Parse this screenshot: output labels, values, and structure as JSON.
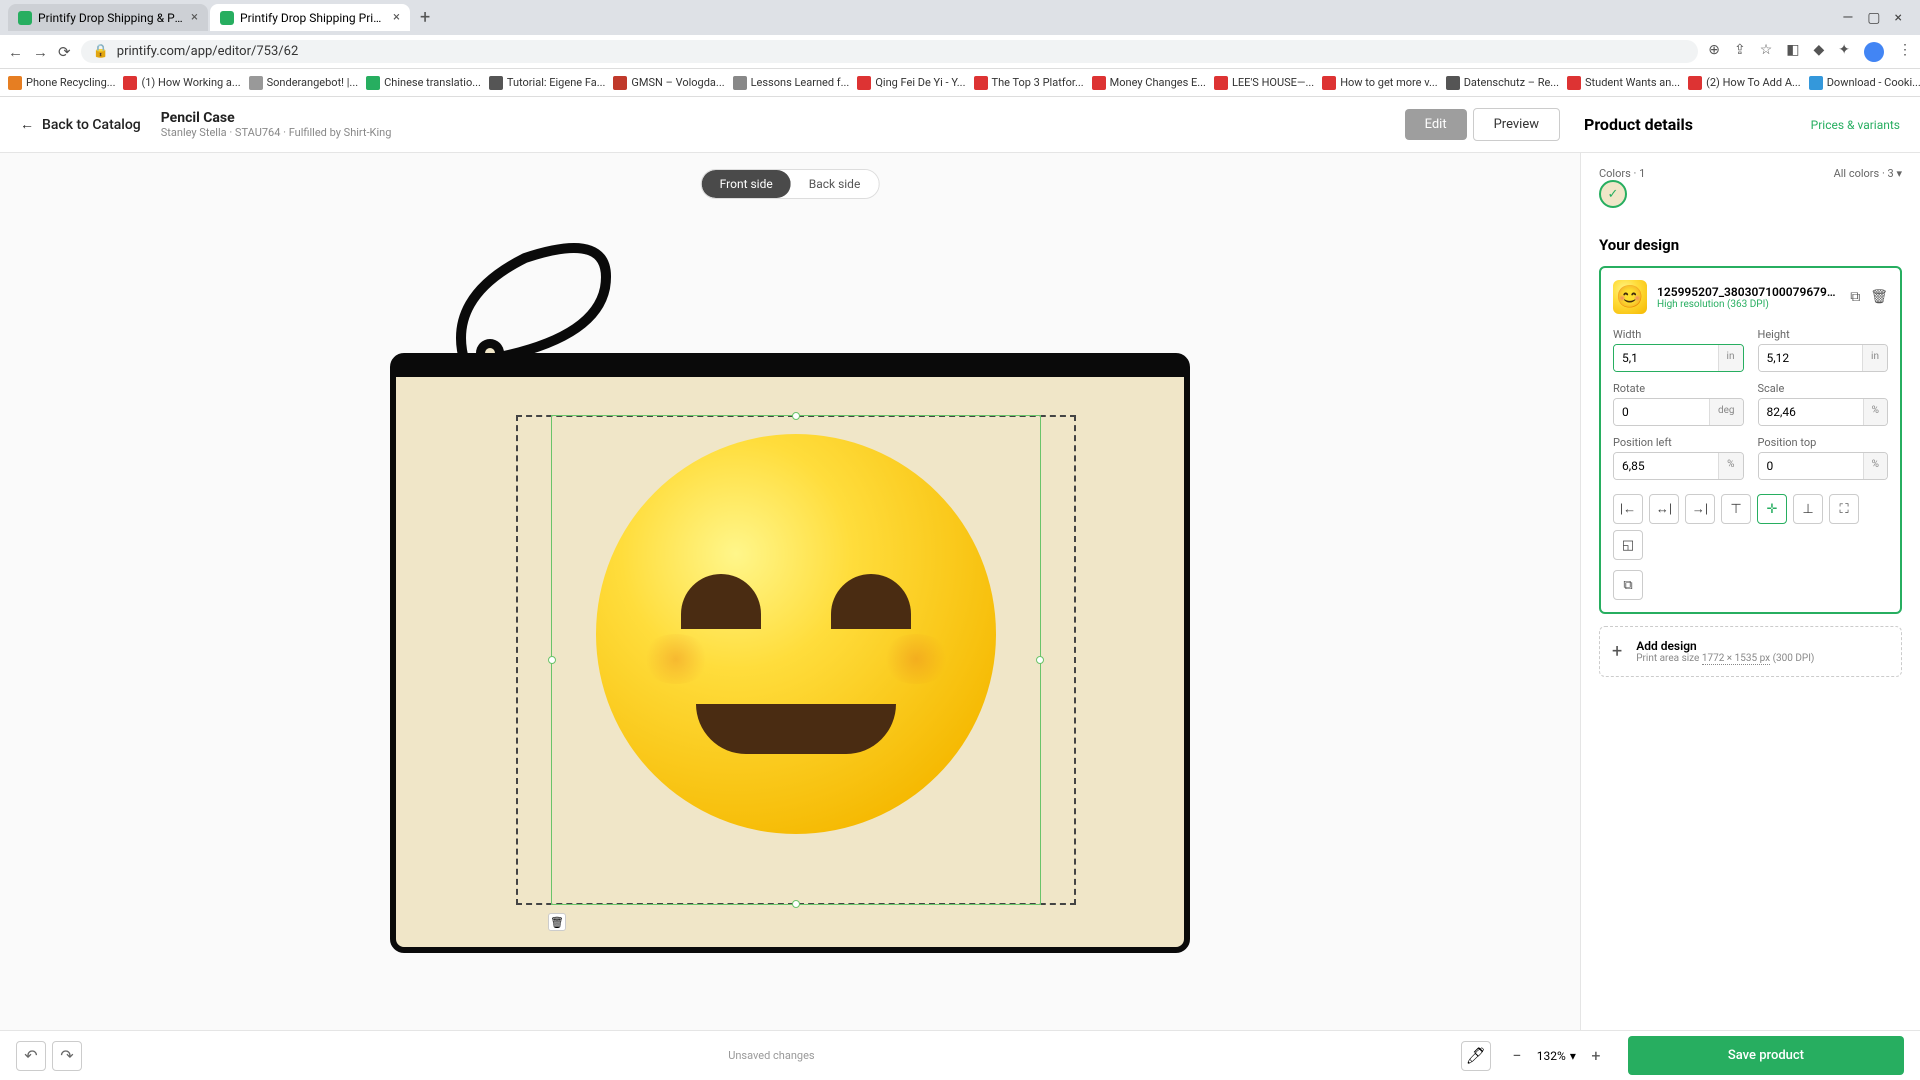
{
  "browser": {
    "tabs": [
      {
        "title": "Printify Drop Shipping & Printi..."
      },
      {
        "title": "Printify Drop Shipping Print o..."
      }
    ],
    "url": "printify.com/app/editor/753/62",
    "bookmarks": [
      "Phone Recycling...",
      "(1) How Working a...",
      "Sonderangebot! |...",
      "Chinese translatio...",
      "Tutorial: Eigene Fa...",
      "GMSN – Vologda...",
      "Lessons Learned f...",
      "Qing Fei De Yi - Y...",
      "The Top 3 Platfor...",
      "Money Changes E...",
      "LEE'S HOUSE—...",
      "How to get more v...",
      "Datenschutz – Re...",
      "Student Wants an...",
      "(2) How To Add A...",
      "Download - Cooki..."
    ]
  },
  "header": {
    "back": "Back to Catalog",
    "title": "Pencil Case",
    "subtitle": "Stanley Stella · STAU764 · Fulfilled by Shirt-King",
    "edit": "Edit",
    "preview": "Preview",
    "details_title": "Product details",
    "prices_link": "Prices & variants"
  },
  "sides": {
    "front": "Front side",
    "back": "Back side"
  },
  "colors": {
    "label": "Colors · 1",
    "all": "All colors · 3"
  },
  "design": {
    "section_title": "Your design",
    "filename": "125995207_3803071000796799...",
    "resolution": "High resolution (363 DPI)",
    "fields": {
      "width_label": "Width",
      "width_val": "5,1",
      "width_unit": "in",
      "height_label": "Height",
      "height_val": "5,12",
      "height_unit": "in",
      "rotate_label": "Rotate",
      "rotate_val": "0",
      "rotate_unit": "deg",
      "scale_label": "Scale",
      "scale_val": "82,46",
      "scale_unit": "%",
      "posl_label": "Position left",
      "posl_val": "6,85",
      "posl_unit": "%",
      "post_label": "Position top",
      "post_val": "0",
      "post_unit": "%"
    }
  },
  "add_design": {
    "title": "Add design",
    "sub_prefix": "Print area size ",
    "sub_size": "1772 × 1535 px",
    "sub_suffix": " (300 DPI)"
  },
  "footer": {
    "status": "Unsaved changes",
    "zoom": "132%",
    "save": "Save product"
  }
}
